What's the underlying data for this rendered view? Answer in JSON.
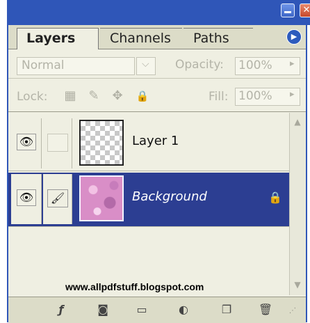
{
  "window": {
    "minimize_icon": "minimize-icon",
    "close_icon": "close-icon",
    "close_glyph": "✕",
    "frame_color": "#2f56b8"
  },
  "tabs": [
    {
      "label": "Layers",
      "active": true
    },
    {
      "label": "Channels",
      "active": false
    },
    {
      "label": "Paths",
      "active": false
    }
  ],
  "panel_menu": {
    "glyph": "▶",
    "icon": "panel-menu-icon"
  },
  "options": {
    "blend_mode": "Normal",
    "blend_arrow": "⌵",
    "opacity_label": "Opacity:",
    "opacity_value": "100%",
    "opacity_arrow": "▸",
    "lock_label": "Lock:",
    "lock_icons": [
      {
        "name": "lock-transparency-icon",
        "glyph": "▦"
      },
      {
        "name": "lock-image-brush-icon",
        "glyph": "✎"
      },
      {
        "name": "lock-position-move-icon",
        "glyph": "✥"
      },
      {
        "name": "lock-all-icon",
        "glyph": "🔒"
      }
    ],
    "fill_label": "Fill:",
    "fill_value": "100%",
    "fill_arrow": "▸"
  },
  "layers": [
    {
      "name": "Layer 1",
      "visible": true,
      "eye_glyph": "👁",
      "selected": false
    },
    {
      "name": "Background",
      "visible": true,
      "eye_glyph": "👁",
      "brush_glyph": "🖌",
      "selected": true,
      "lock_glyph": "🔒",
      "selected_color": "#2c3e92"
    }
  ],
  "watermark": "www.allpdfstuff.blogspot.com",
  "scroll": {
    "up": "▲",
    "down": "▼"
  },
  "toolbar": [
    {
      "name": "layer-style-icon",
      "glyph": "ƒ"
    },
    {
      "name": "add-mask-icon",
      "glyph": "◙"
    },
    {
      "name": "new-group-folder-icon",
      "glyph": "▭"
    },
    {
      "name": "new-adjustment-layer-icon",
      "glyph": "◐"
    },
    {
      "name": "new-layer-icon",
      "glyph": "❐"
    },
    {
      "name": "delete-layer-trash-icon",
      "glyph": "🗑"
    }
  ],
  "resize_grip": "⋰"
}
